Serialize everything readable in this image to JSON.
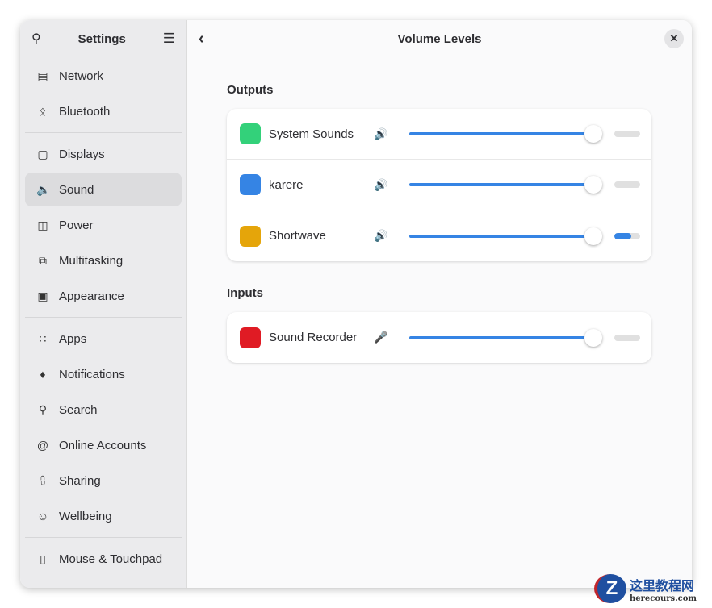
{
  "sidebar": {
    "title": "Settings",
    "groups": [
      [
        {
          "label": "Network",
          "icon": "network-icon"
        },
        {
          "label": "Bluetooth",
          "icon": "bluetooth-icon"
        }
      ],
      [
        {
          "label": "Displays",
          "icon": "display-icon"
        },
        {
          "label": "Sound",
          "icon": "sound-icon",
          "selected": true
        },
        {
          "label": "Power",
          "icon": "power-icon"
        },
        {
          "label": "Multitasking",
          "icon": "multitasking-icon"
        },
        {
          "label": "Appearance",
          "icon": "appearance-icon"
        }
      ],
      [
        {
          "label": "Apps",
          "icon": "apps-icon"
        },
        {
          "label": "Notifications",
          "icon": "bell-icon"
        },
        {
          "label": "Search",
          "icon": "search-icon"
        },
        {
          "label": "Online Accounts",
          "icon": "at-icon"
        },
        {
          "label": "Sharing",
          "icon": "share-icon"
        },
        {
          "label": "Wellbeing",
          "icon": "wellbeing-icon"
        }
      ],
      [
        {
          "label": "Mouse & Touchpad",
          "icon": "mouse-icon"
        }
      ]
    ]
  },
  "header": {
    "title": "Volume Levels"
  },
  "outputs": {
    "label": "Outputs",
    "items": [
      {
        "name": "System Sounds",
        "volume": 100,
        "level": 0,
        "color": "#33d17a"
      },
      {
        "name": "karere",
        "volume": 100,
        "level": 0,
        "color": "#3584e4"
      },
      {
        "name": "Shortwave",
        "volume": 100,
        "level": 65,
        "color": "#e5a50a"
      }
    ]
  },
  "inputs": {
    "label": "Inputs",
    "items": [
      {
        "name": "Sound Recorder",
        "volume": 100,
        "level": 0,
        "color": "#e01b24"
      }
    ]
  },
  "watermark": {
    "title": "这里教程网",
    "url": "herecours.com"
  }
}
